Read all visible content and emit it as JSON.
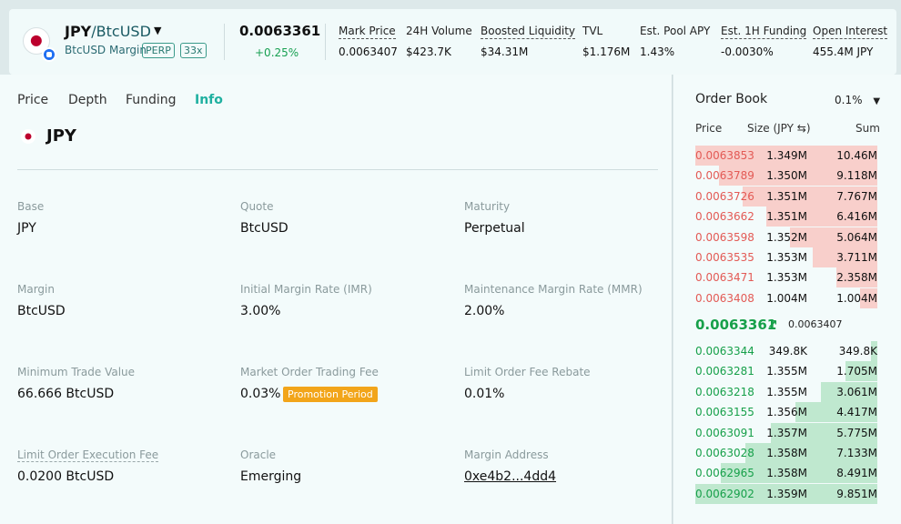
{
  "header": {
    "pair_base": "JPY",
    "pair_sep": "/",
    "pair_quote": "BtcUSD",
    "margin_label": "BtcUSD Margin",
    "badge_type": "PERP",
    "badge_leverage": "33x",
    "price": "0.0063361",
    "change": "+0.25%",
    "stats": [
      {
        "label": "Mark Price",
        "value": "0.0063407"
      },
      {
        "label": "24H Volume",
        "value": "$423.7K"
      },
      {
        "label": "Boosted Liquidity",
        "value": "$34.31M"
      },
      {
        "label": "TVL",
        "value": "$1.176M"
      },
      {
        "label": "Est. Pool APY",
        "value": "1.43%"
      },
      {
        "label": "Est. 1H Funding",
        "value": "-0.0030%"
      },
      {
        "label": "Open Interest",
        "value": "455.4M JPY"
      }
    ]
  },
  "tabs": [
    "Price",
    "Depth",
    "Funding",
    "Info"
  ],
  "active_tab": "Info",
  "info": {
    "symbol": "JPY",
    "fields": [
      {
        "label": "Base",
        "value": "JPY"
      },
      {
        "label": "Quote",
        "value": "BtcUSD"
      },
      {
        "label": "Maturity",
        "value": "Perpetual"
      },
      {
        "label": "Margin",
        "value": "BtcUSD"
      },
      {
        "label": "Initial Margin Rate (IMR)",
        "value": "3.00%"
      },
      {
        "label": "Maintenance Margin Rate (MMR)",
        "value": "2.00%"
      },
      {
        "label": "Minimum Trade Value",
        "value": "66.666 BtcUSD"
      },
      {
        "label": "Market Order Trading Fee",
        "value": "0.03%"
      },
      {
        "label": "Limit Order Fee Rebate",
        "value": "0.01%"
      },
      {
        "label": "Limit Order Execution Fee",
        "value": "0.0200 BtcUSD"
      },
      {
        "label": "Oracle",
        "value": "Emerging"
      },
      {
        "label": "Margin Address",
        "value": "0xe4b2...4dd4"
      }
    ],
    "promo": "Promotion Period"
  },
  "orderbook": {
    "title": "Order Book",
    "step": "0.1%",
    "col_price": "Price",
    "col_size": "Size (JPY ⇆)",
    "col_sum": "Sum",
    "asks": [
      {
        "price": "0.0063853",
        "size": "1.349M",
        "sum": "10.46M",
        "depth": 1.0
      },
      {
        "price": "0.0063789",
        "size": "1.350M",
        "sum": "9.118M",
        "depth": 0.87
      },
      {
        "price": "0.0063726",
        "size": "1.351M",
        "sum": "7.767M",
        "depth": 0.74
      },
      {
        "price": "0.0063662",
        "size": "1.351M",
        "sum": "6.416M",
        "depth": 0.61
      },
      {
        "price": "0.0063598",
        "size": "1.352M",
        "sum": "5.064M",
        "depth": 0.48
      },
      {
        "price": "0.0063535",
        "size": "1.353M",
        "sum": "3.711M",
        "depth": 0.355
      },
      {
        "price": "0.0063471",
        "size": "1.353M",
        "sum": "2.358M",
        "depth": 0.225
      },
      {
        "price": "0.0063408",
        "size": "1.004M",
        "sum": "1.004M",
        "depth": 0.096
      }
    ],
    "mid_price": "0.0063361",
    "mid_mark": "0.0063407",
    "bids": [
      {
        "price": "0.0063344",
        "size": "349.8K",
        "sum": "349.8K",
        "depth": 0.036
      },
      {
        "price": "0.0063281",
        "size": "1.355M",
        "sum": "1.705M",
        "depth": 0.173
      },
      {
        "price": "0.0063218",
        "size": "1.355M",
        "sum": "3.061M",
        "depth": 0.311
      },
      {
        "price": "0.0063155",
        "size": "1.356M",
        "sum": "4.417M",
        "depth": 0.448
      },
      {
        "price": "0.0063091",
        "size": "1.357M",
        "sum": "5.775M",
        "depth": 0.586
      },
      {
        "price": "0.0063028",
        "size": "1.358M",
        "sum": "7.133M",
        "depth": 0.724
      },
      {
        "price": "0.0062965",
        "size": "1.358M",
        "sum": "8.491M",
        "depth": 0.862
      },
      {
        "price": "0.0062902",
        "size": "1.359M",
        "sum": "9.851M",
        "depth": 1.0
      }
    ]
  },
  "colors": {
    "accent": "#1fb0a0",
    "ask": "#e35a55",
    "bid": "#17a04a",
    "flag": "#bc002d"
  },
  "icons": [
    "jpy-flag-icon",
    "btcusd-coin-icon",
    "chevron-down-icon",
    "arrow-up-right-icon"
  ]
}
